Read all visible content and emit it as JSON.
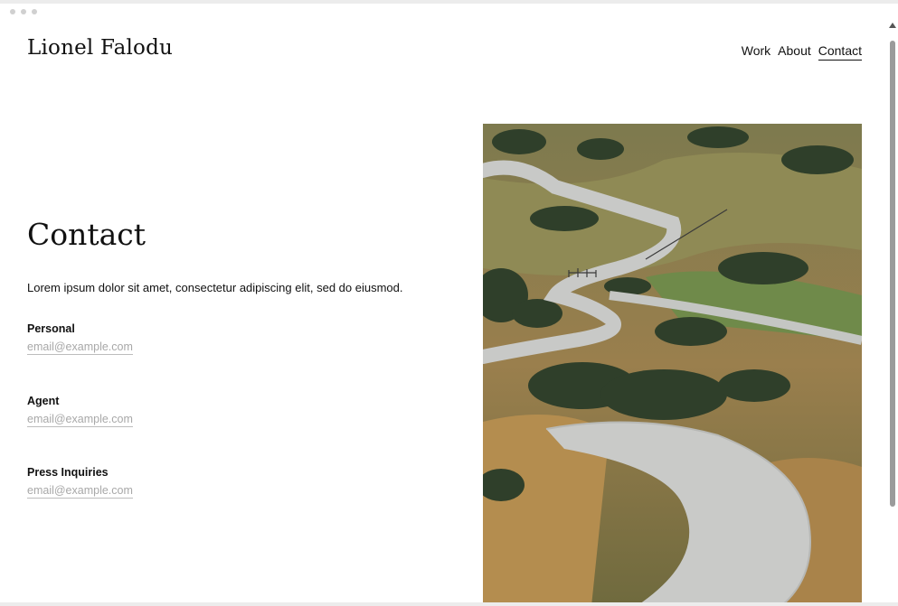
{
  "site": {
    "title": "Lionel Falodu"
  },
  "nav": {
    "items": [
      {
        "label": "Work"
      },
      {
        "label": "About"
      },
      {
        "label": "Contact"
      }
    ],
    "active": "Contact"
  },
  "page": {
    "heading": "Contact",
    "intro": "Lorem ipsum dolor sit amet, consectetur adipiscing elit, sed do eiusmod."
  },
  "contacts": [
    {
      "label": "Personal",
      "email": "email@example.com"
    },
    {
      "label": "Agent",
      "email": "email@example.com"
    },
    {
      "label": "Press Inquiries",
      "email": "email@example.com"
    }
  ],
  "colors": {
    "text": "#111111",
    "link_muted": "#a8a8a8",
    "background": "#ffffff"
  },
  "icons": {
    "scroll_up": "triangle-up-icon"
  }
}
